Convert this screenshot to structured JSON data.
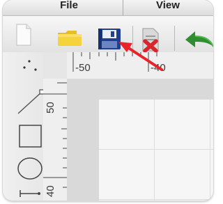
{
  "menu": {
    "file_label": "File",
    "view_label": "View"
  },
  "toolbar": {
    "tools": [
      "new-document",
      "open-folder",
      "save",
      "delete",
      "undo"
    ]
  },
  "ruler": {
    "h_labels": [
      "-50",
      "-40"
    ],
    "v_labels": [
      "50",
      "40"
    ]
  },
  "palette": {
    "tools": [
      "selection-dots",
      "line",
      "rectangle",
      "ellipse",
      "connector"
    ]
  },
  "annotation": {
    "arrow_color": "#e8232a",
    "points_to": "save"
  },
  "colors": {
    "folder": "#f5d33a",
    "save": "#1f3f8f",
    "delete": "#d8262c",
    "undo": "#2f8f2f"
  }
}
